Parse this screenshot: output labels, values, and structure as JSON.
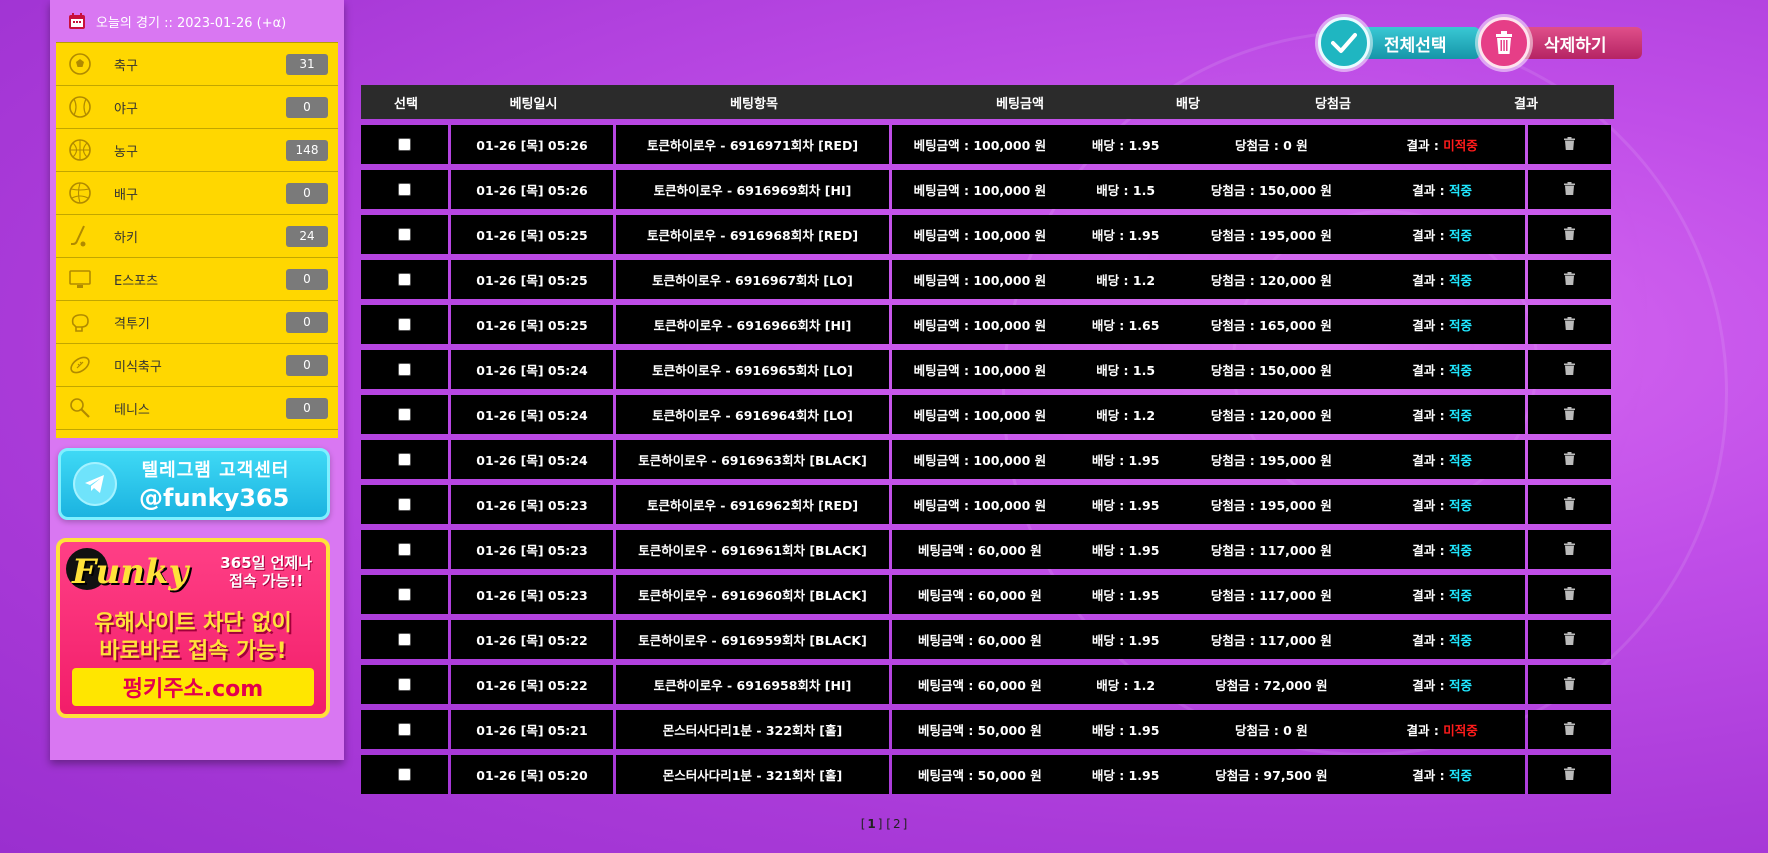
{
  "header": {
    "today_label": "오늘의 경기 :: 2023-01-26 (+α)"
  },
  "sports": [
    {
      "label": "축구",
      "count": "31",
      "icon": "soccer-ball-icon"
    },
    {
      "label": "야구",
      "count": "0",
      "icon": "baseball-icon"
    },
    {
      "label": "농구",
      "count": "148",
      "icon": "basketball-icon"
    },
    {
      "label": "배구",
      "count": "0",
      "icon": "volleyball-icon"
    },
    {
      "label": "하키",
      "count": "24",
      "icon": "hockey-stick-icon"
    },
    {
      "label": "E스포츠",
      "count": "0",
      "icon": "monitor-icon"
    },
    {
      "label": "격투기",
      "count": "0",
      "icon": "boxing-glove-icon"
    },
    {
      "label": "미식축구",
      "count": "0",
      "icon": "football-icon"
    },
    {
      "label": "테니스",
      "count": "0",
      "icon": "tennis-racket-icon"
    }
  ],
  "telegram_banner": {
    "title": "텔레그램 고객센터",
    "handle": "@funky365"
  },
  "funky_banner": {
    "logo": "Funky",
    "side_line1": "365일 언제나",
    "side_line2": "접속 가능!!",
    "main_line1": "유해사이트 차단 없이",
    "main_line2": "바로바로 접속 가능!",
    "button": "펑키주소.com"
  },
  "buttons": {
    "select_all": "전체선택",
    "delete": "삭제하기"
  },
  "table": {
    "headers": [
      "선택",
      "베팅일시",
      "베팅항목",
      "베팅금액",
      "배당",
      "당첨금",
      "결과"
    ],
    "rows": [
      {
        "date": "01-26 [목] 05:26",
        "item": "토큰하이로우 - 6916971회차 [RED]",
        "amount": "베팅금액 : 100,000 원",
        "odds": "배당 : 1.95",
        "win": "당첨금 : 0 원",
        "result_label": "결과 : ",
        "result": "미적중",
        "status": "lose"
      },
      {
        "date": "01-26 [목] 05:26",
        "item": "토큰하이로우 - 6916969회차 [HI]",
        "amount": "베팅금액 : 100,000 원",
        "odds": "배당 : 1.5",
        "win": "당첨금 : 150,000 원",
        "result_label": "결과 : ",
        "result": "적중",
        "status": "win"
      },
      {
        "date": "01-26 [목] 05:25",
        "item": "토큰하이로우 - 6916968회차 [RED]",
        "amount": "베팅금액 : 100,000 원",
        "odds": "배당 : 1.95",
        "win": "당첨금 : 195,000 원",
        "result_label": "결과 : ",
        "result": "적중",
        "status": "win"
      },
      {
        "date": "01-26 [목] 05:25",
        "item": "토큰하이로우 - 6916967회차 [LO]",
        "amount": "베팅금액 : 100,000 원",
        "odds": "배당 : 1.2",
        "win": "당첨금 : 120,000 원",
        "result_label": "결과 : ",
        "result": "적중",
        "status": "win"
      },
      {
        "date": "01-26 [목] 05:25",
        "item": "토큰하이로우 - 6916966회차 [HI]",
        "amount": "베팅금액 : 100,000 원",
        "odds": "배당 : 1.65",
        "win": "당첨금 : 165,000 원",
        "result_label": "결과 : ",
        "result": "적중",
        "status": "win"
      },
      {
        "date": "01-26 [목] 05:24",
        "item": "토큰하이로우 - 6916965회차 [LO]",
        "amount": "베팅금액 : 100,000 원",
        "odds": "배당 : 1.5",
        "win": "당첨금 : 150,000 원",
        "result_label": "결과 : ",
        "result": "적중",
        "status": "win"
      },
      {
        "date": "01-26 [목] 05:24",
        "item": "토큰하이로우 - 6916964회차 [LO]",
        "amount": "베팅금액 : 100,000 원",
        "odds": "배당 : 1.2",
        "win": "당첨금 : 120,000 원",
        "result_label": "결과 : ",
        "result": "적중",
        "status": "win"
      },
      {
        "date": "01-26 [목] 05:24",
        "item": "토큰하이로우 - 6916963회차 [BLACK]",
        "amount": "베팅금액 : 100,000 원",
        "odds": "배당 : 1.95",
        "win": "당첨금 : 195,000 원",
        "result_label": "결과 : ",
        "result": "적중",
        "status": "win"
      },
      {
        "date": "01-26 [목] 05:23",
        "item": "토큰하이로우 - 6916962회차 [RED]",
        "amount": "베팅금액 : 100,000 원",
        "odds": "배당 : 1.95",
        "win": "당첨금 : 195,000 원",
        "result_label": "결과 : ",
        "result": "적중",
        "status": "win"
      },
      {
        "date": "01-26 [목] 05:23",
        "item": "토큰하이로우 - 6916961회차 [BLACK]",
        "amount": "베팅금액 : 60,000 원",
        "odds": "배당 : 1.95",
        "win": "당첨금 : 117,000 원",
        "result_label": "결과 : ",
        "result": "적중",
        "status": "win"
      },
      {
        "date": "01-26 [목] 05:23",
        "item": "토큰하이로우 - 6916960회차 [BLACK]",
        "amount": "베팅금액 : 60,000 원",
        "odds": "배당 : 1.95",
        "win": "당첨금 : 117,000 원",
        "result_label": "결과 : ",
        "result": "적중",
        "status": "win"
      },
      {
        "date": "01-26 [목] 05:22",
        "item": "토큰하이로우 - 6916959회차 [BLACK]",
        "amount": "베팅금액 : 60,000 원",
        "odds": "배당 : 1.95",
        "win": "당첨금 : 117,000 원",
        "result_label": "결과 : ",
        "result": "적중",
        "status": "win"
      },
      {
        "date": "01-26 [목] 05:22",
        "item": "토큰하이로우 - 6916958회차 [HI]",
        "amount": "베팅금액 : 60,000 원",
        "odds": "배당 : 1.2",
        "win": "당첨금 : 72,000 원",
        "result_label": "결과 : ",
        "result": "적중",
        "status": "win"
      },
      {
        "date": "01-26 [목] 05:21",
        "item": "몬스터사다리1분 - 322회차 [홀]",
        "amount": "베팅금액 : 50,000 원",
        "odds": "배당 : 1.95",
        "win": "당첨금 : 0 원",
        "result_label": "결과 : ",
        "result": "미적중",
        "status": "lose"
      },
      {
        "date": "01-26 [목] 05:20",
        "item": "몬스터사다리1분 - 321회차 [홀]",
        "amount": "베팅금액 : 50,000 원",
        "odds": "배당 : 1.95",
        "win": "당첨금 : 97,500 원",
        "result_label": "결과 : ",
        "result": "적중",
        "status": "win"
      }
    ]
  },
  "pagination": {
    "pages": [
      "1",
      "2"
    ],
    "current": "1"
  },
  "colors": {
    "win": "#1fe7ff",
    "lose": "#ff1b1b",
    "sidebar_bg": "#d977f2",
    "sport_bg": "#ffd700"
  }
}
